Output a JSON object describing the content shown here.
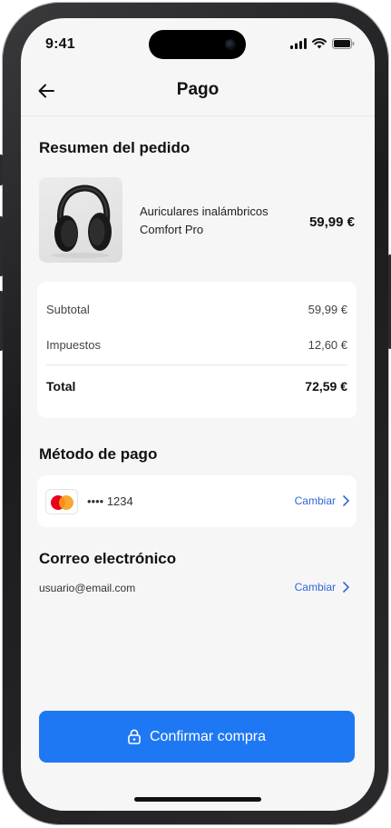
{
  "status_bar": {
    "time": "9:41"
  },
  "nav": {
    "title": "Pago"
  },
  "order_summary": {
    "title": "Resumen del pedido",
    "product": {
      "name_line1": "Auriculares inalámbricos",
      "name_line2": "Comfort Pro",
      "price": "59,99 €"
    },
    "rows": {
      "subtotal_label": "Subtotal",
      "subtotal_value": "59,99 €",
      "taxes_label": "Impuestos",
      "taxes_value": "12,60 €",
      "total_label": "Total",
      "total_value": "72,59 €"
    }
  },
  "payment": {
    "title": "Método de pago",
    "card_number": "•••• 1234",
    "change_label": "Cambiar"
  },
  "email": {
    "title": "Correo electrónico",
    "value": "usuario@email.com",
    "change_label": "Cambiar"
  },
  "confirm_button": {
    "label": "Confirmar compra"
  },
  "colors": {
    "accent": "#1f78f3",
    "link": "#2e68d6",
    "background": "#f6f6f7"
  }
}
